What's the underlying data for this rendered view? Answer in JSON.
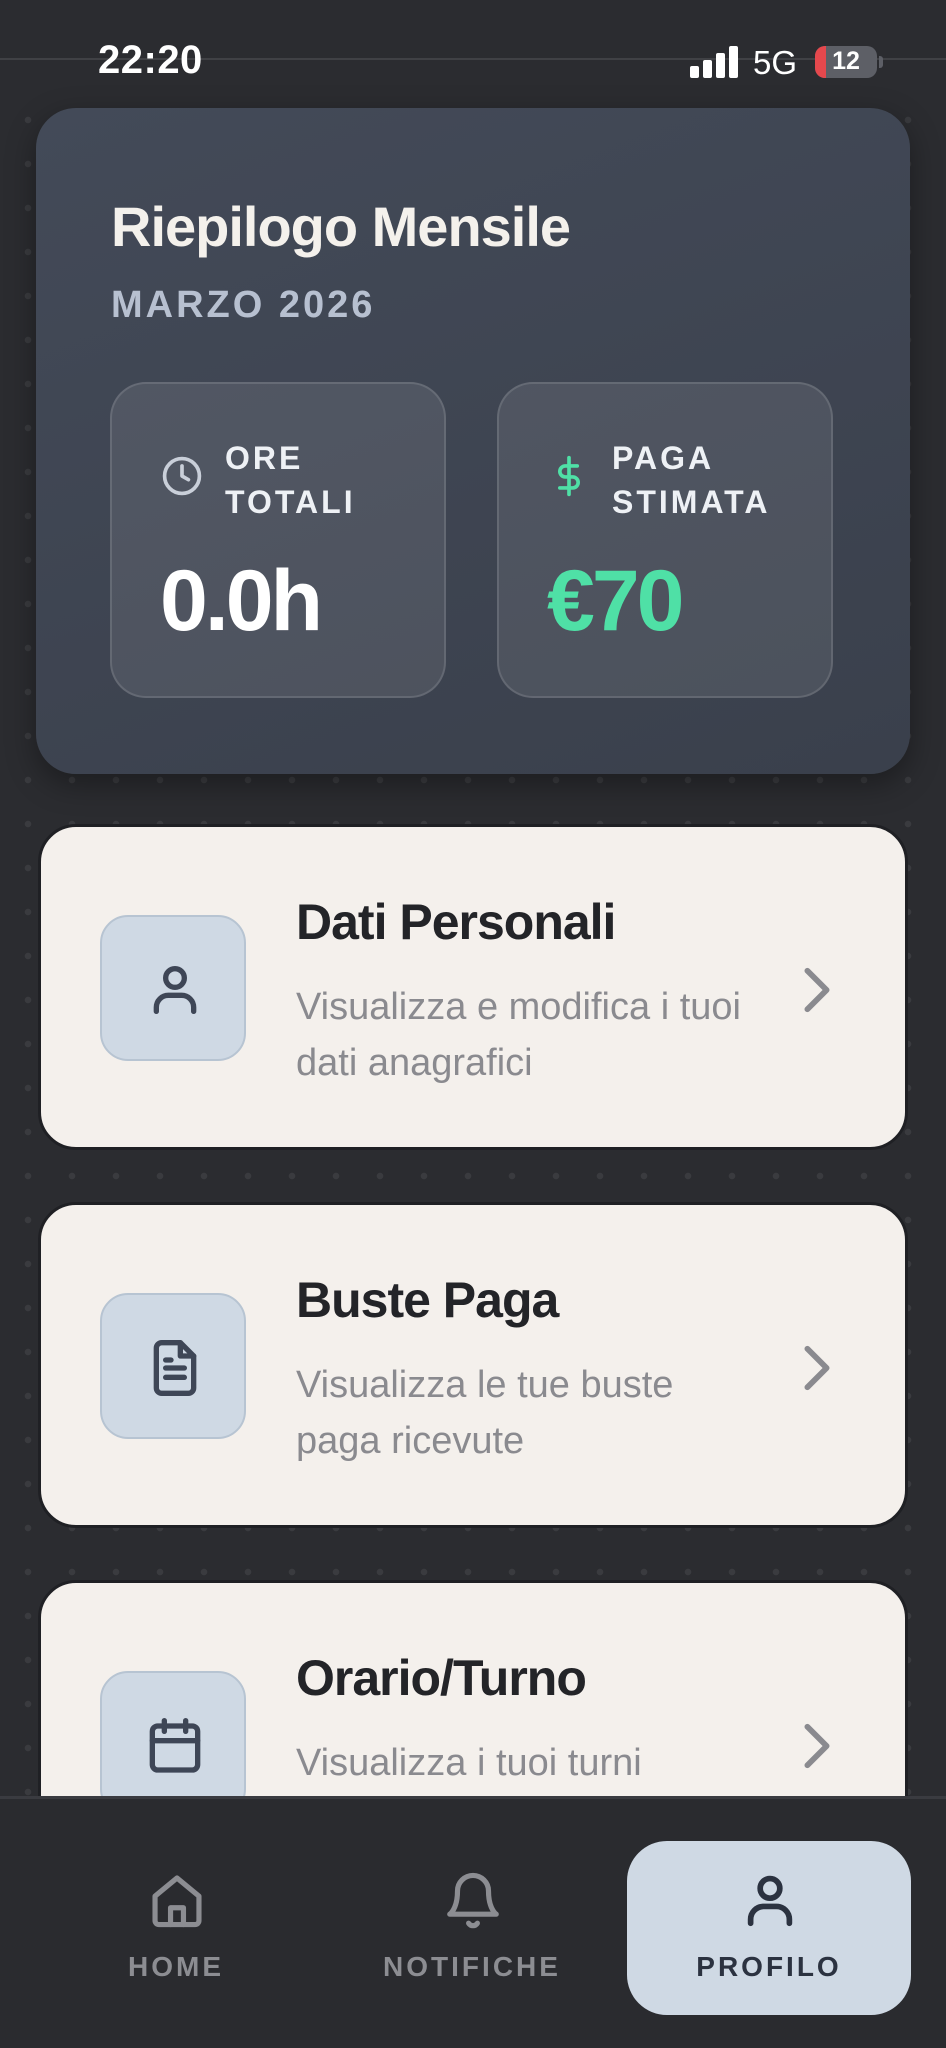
{
  "status_bar": {
    "time": "22:20",
    "network": "5G",
    "battery": "12",
    "battery_level_percent": 12
  },
  "summary": {
    "title": "Riepilogo Mensile",
    "month": "MARZO 2026",
    "hours": {
      "icon": "clock-icon",
      "label": "ORE TOTALI",
      "value": "0.0h"
    },
    "pay": {
      "icon": "dollar-icon",
      "label": "PAGA STIMATA",
      "value": "€70",
      "color": "#4fe0a6"
    }
  },
  "menu": [
    {
      "icon": "user-icon",
      "title": "Dati Personali",
      "subtitle": "Visualizza e modifica i tuoi dati anagrafici"
    },
    {
      "icon": "document-icon",
      "title": "Buste Paga",
      "subtitle": "Visualizza le tue buste paga ricevute"
    },
    {
      "icon": "calendar-icon",
      "title": "Orario/Turno",
      "subtitle": "Visualizza i tuoi turni"
    }
  ],
  "nav": {
    "home": "HOME",
    "notifications": "NOTIFICHE",
    "profile": "PROFILO",
    "active": "profile",
    "active_color": "#cfd9e4"
  }
}
